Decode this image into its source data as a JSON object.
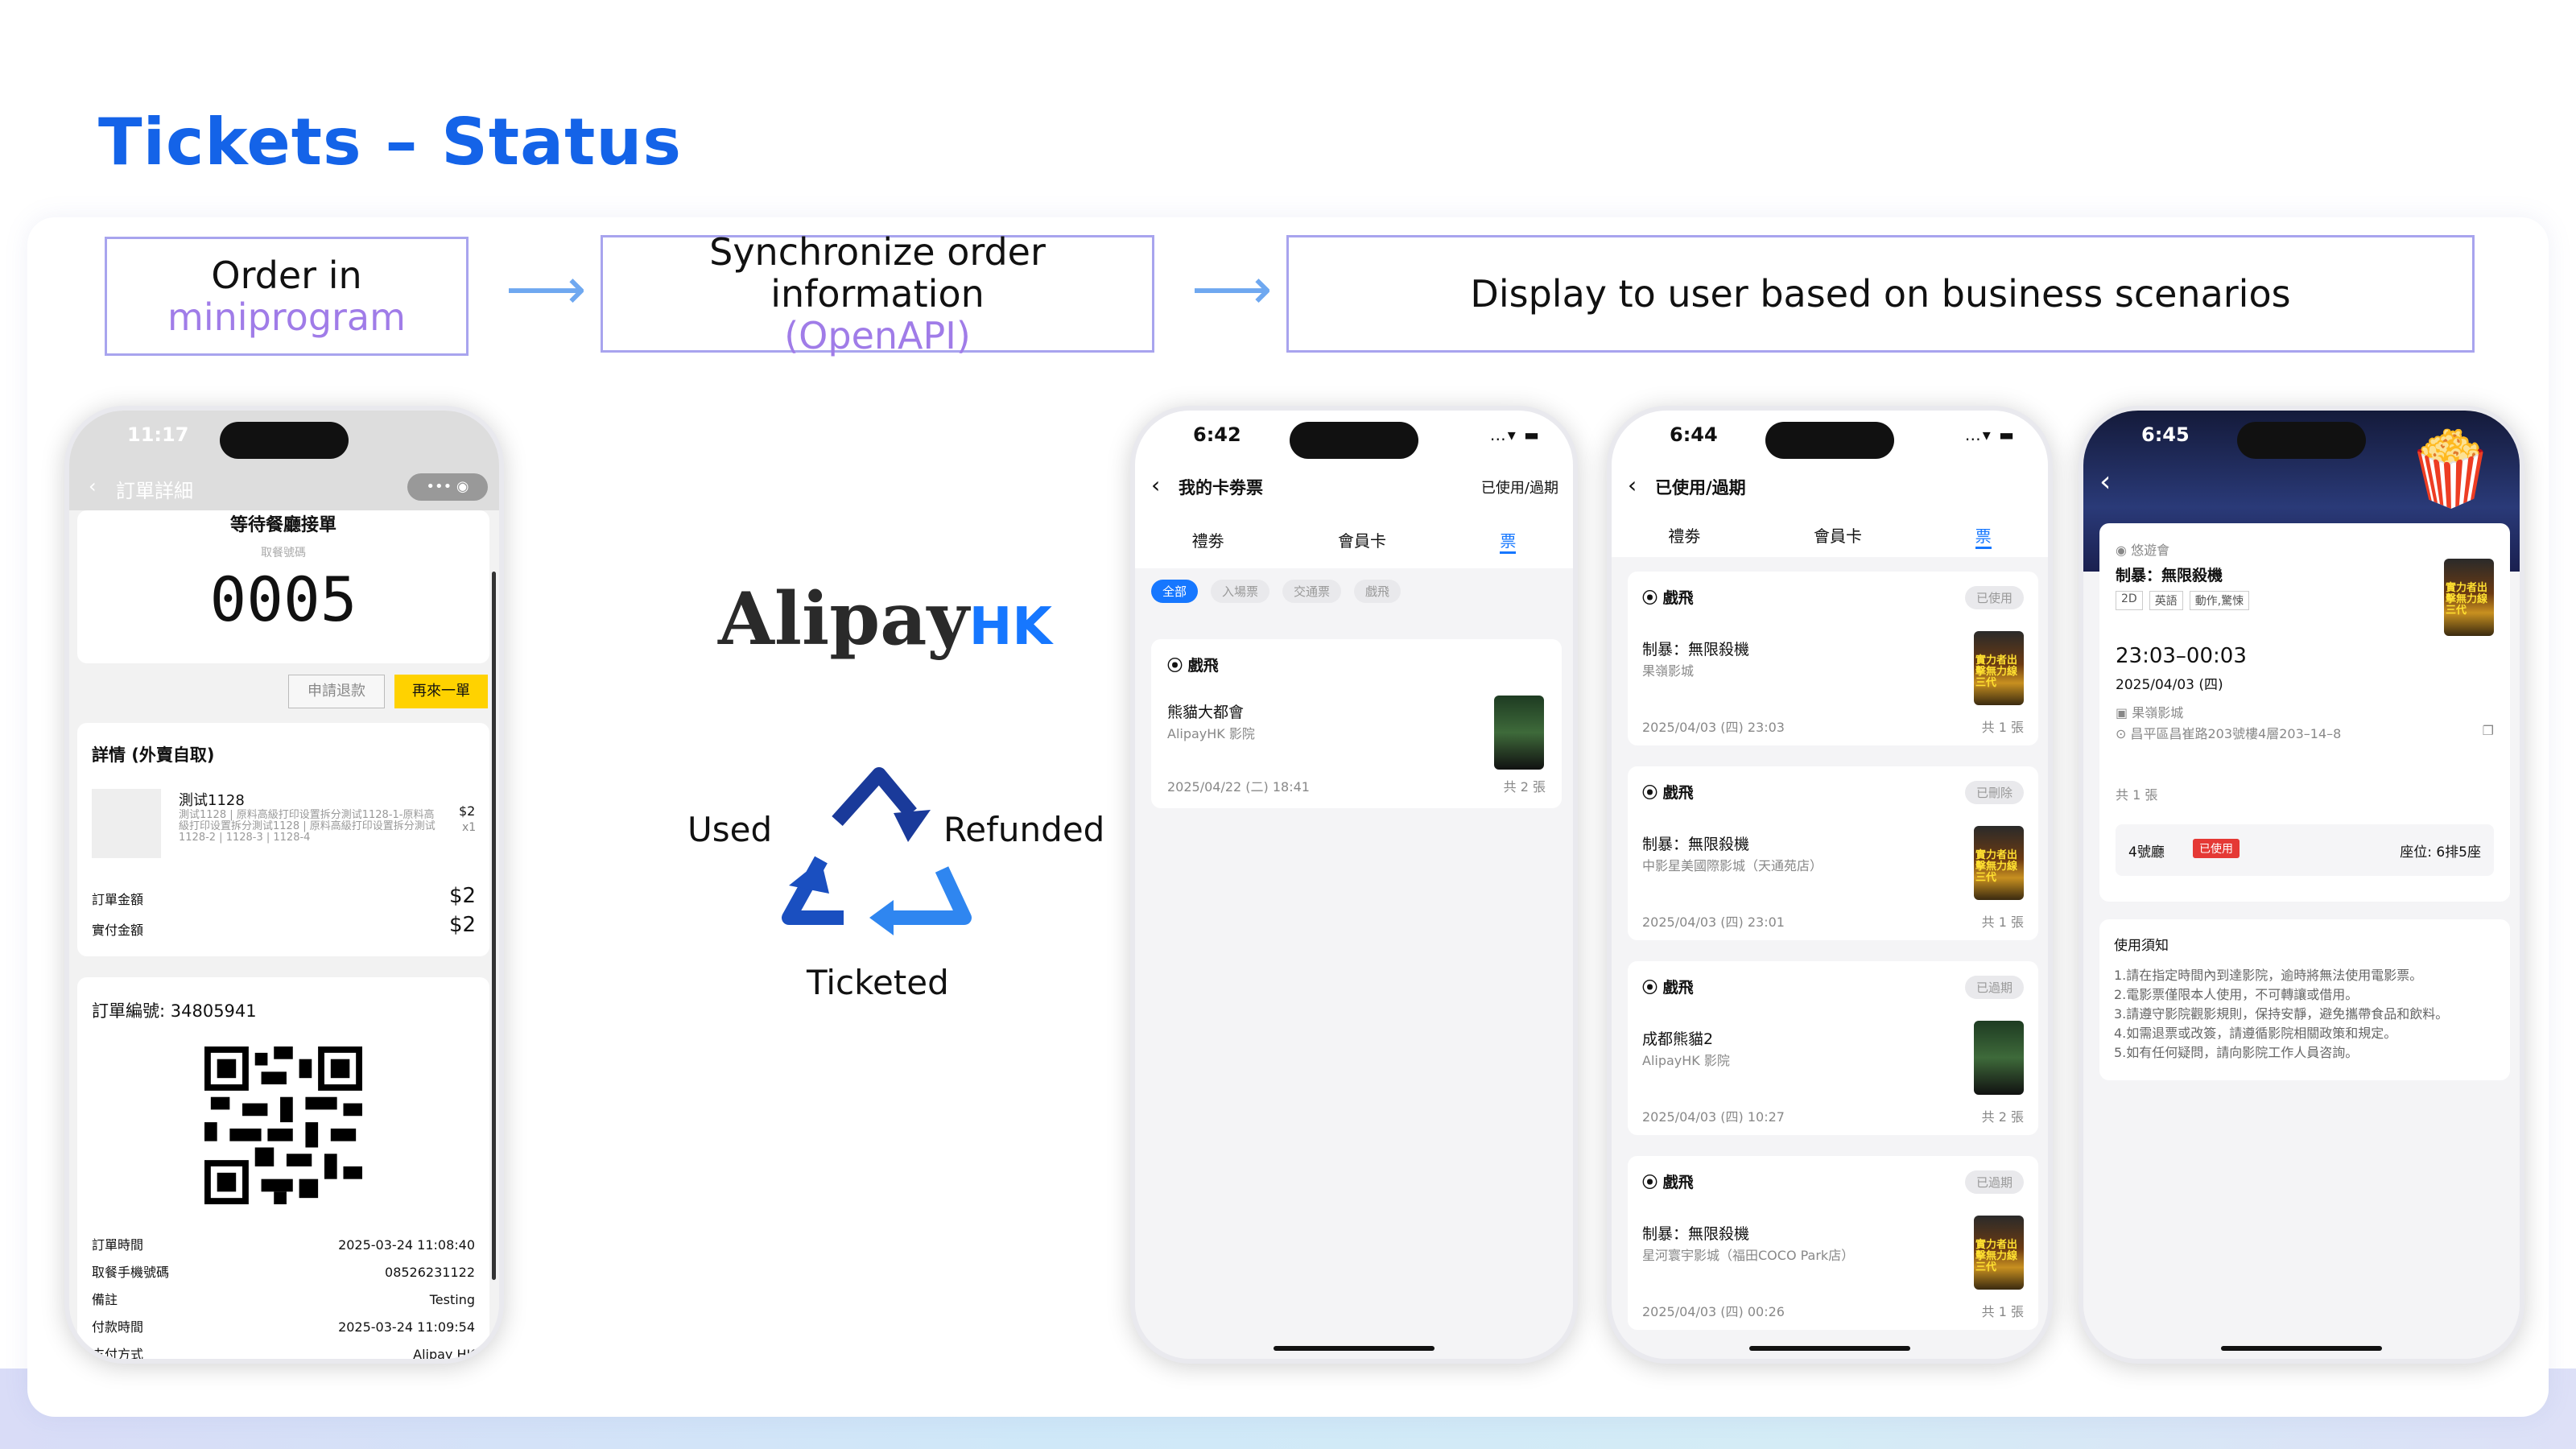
{
  "title": "Tickets – Status",
  "steps": [
    {
      "line1": "Order in",
      "line2": "miniprogram"
    },
    {
      "line1": "Synchronize order information",
      "line2": "(OpenAPI)"
    },
    {
      "line1": "Display to user based on business scenarios"
    }
  ],
  "cycle": {
    "brand_main": "Alipay",
    "brand_suffix": "HK",
    "used": "Used",
    "refunded": "Refunded",
    "ticketed": "Ticketed"
  },
  "phone1": {
    "time": "11:17",
    "nav_title": "訂單詳細",
    "more": "•••",
    "status": "等待餐廳接單",
    "pickup_label": "取餐號碼",
    "pickup_no": "0005",
    "refund_btn": "申請退款",
    "reorder_btn": "再來一單",
    "detail_title": "詳情 (外賣自取)",
    "item_name": "測试1128",
    "item_desc": "測试1128 | 原料高級打印设置拆分測试1128-1-原料高級打印设置拆分測试1128 | 原料高級打印设置拆分測试1128-2 | 1128-3 | 1128-4",
    "item_price": "$2",
    "item_qty": "x1",
    "order_amount_label": "訂單金額",
    "order_amount": "$2",
    "paid_label": "實付金額",
    "paid": "$2",
    "order_no_label": "訂單編號: 34805941",
    "rows": [
      {
        "k": "訂單時間",
        "v": "2025-03-24 11:08:40"
      },
      {
        "k": "取餐手機號碼",
        "v": "08526231122"
      },
      {
        "k": "備註",
        "v": "Testing"
      },
      {
        "k": "付款時間",
        "v": "2025-03-24 11:09:54"
      },
      {
        "k": "支付方式",
        "v": "Alipay HK"
      }
    ]
  },
  "phone2": {
    "time": "6:42",
    "nav_title": "我的卡劵票",
    "nav_right": "已使用/過期",
    "tabs": [
      "禮劵",
      "會員卡",
      "票"
    ],
    "chips": [
      "全部",
      "入場票",
      "交通票",
      "戲飛"
    ],
    "card": {
      "cat": "戲飛",
      "name": "熊貓大都會",
      "venue": "AlipayHK 影院",
      "date": "2025/04/22 (二) 18:41",
      "count": "共 2 張"
    }
  },
  "phone3": {
    "time": "6:44",
    "nav_title": "已使用/過期",
    "tabs": [
      "禮劵",
      "會員卡",
      "票"
    ],
    "cards": [
      {
        "cat": "戲飛",
        "badge": "已使用",
        "name": "制暴：無限殺機",
        "venue": "果嶺影城",
        "date": "2025/04/03 (四) 23:03",
        "count": "共 1 張"
      },
      {
        "cat": "戲飛",
        "badge": "已刪除",
        "name": "制暴：無限殺機",
        "venue": "中影星美國際影城（天通苑店）",
        "date": "2025/04/03 (四) 23:01",
        "count": "共 1 張"
      },
      {
        "cat": "戲飛",
        "badge": "已過期",
        "name": "成都熊貓2",
        "venue": "AlipayHK 影院",
        "date": "2025/04/03 (四) 10:27",
        "count": "共 2 張"
      },
      {
        "cat": "戲飛",
        "badge": "已過期",
        "name": "制暴：無限殺機",
        "venue": "星河寰宇影城（福田COCO Park店）",
        "date": "2025/04/03 (四) 00:26",
        "count": "共 1 張"
      }
    ]
  },
  "phone4": {
    "time": "6:45",
    "org": "悠遊會",
    "name": "制暴：無限殺機",
    "tags": [
      "2D",
      "英語",
      "動作,驚悚"
    ],
    "showtime": "23:03–00:03",
    "date": "2025/04/03 (四)",
    "cinema": "果嶺影城",
    "address": "昌平區昌崔路203號樓4層203–14–8",
    "count": "共 1 張",
    "hall": "4號廳",
    "status": "已使用",
    "seat": "座位: 6排5座",
    "notice_title": "使用須知",
    "notices": [
      "1.請在指定時間內到達影院，逾時將無法使用電影票。",
      "2.電影票僅限本人使用，不可轉讓或借用。",
      "3.請遵守影院觀影規則，保持安靜，避免攜帶食品和飲料。",
      "4.如需退票或改簽，請遵循影院相關政策和規定。",
      "5.如有任何疑問，請向影院工作人員咨詢。"
    ]
  },
  "thumb_text": "實力者出擊無力線三代",
  "colors": {
    "title": "#1463e8",
    "accent_purple": "#a07ce8",
    "alipay_blue": "#1677ff",
    "reorder": "#ffd200",
    "used_badge": "#e53935"
  }
}
